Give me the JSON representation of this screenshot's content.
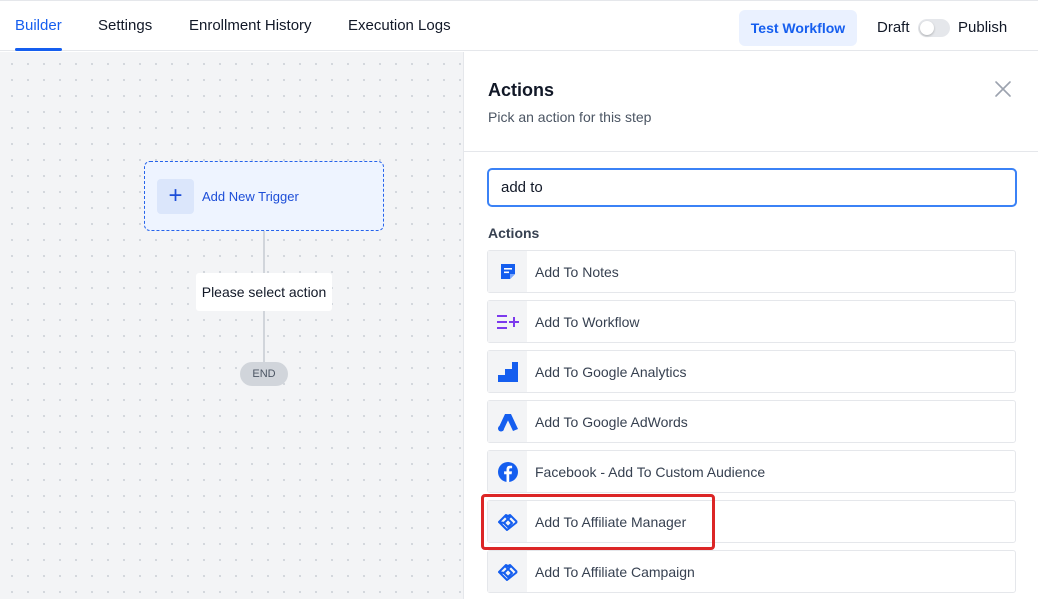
{
  "tabs": [
    {
      "label": "Builder",
      "active": true
    },
    {
      "label": "Settings",
      "active": false
    },
    {
      "label": "Enrollment History",
      "active": false
    },
    {
      "label": "Execution Logs",
      "active": false
    }
  ],
  "header": {
    "test_button": "Test Workflow",
    "draft_label": "Draft",
    "publish_label": "Publish",
    "publish_enabled": false
  },
  "canvas": {
    "trigger_label": "Add New Trigger",
    "action_placeholder": "Please select action",
    "end_label": "END"
  },
  "panel": {
    "title": "Actions",
    "subtitle": "Pick an action for this step",
    "search_value": "add to",
    "section_label": "Actions",
    "items": [
      {
        "label": "Add To Notes",
        "icon": "notes-icon"
      },
      {
        "label": "Add To Workflow",
        "icon": "workflow-icon"
      },
      {
        "label": "Add To Google Analytics",
        "icon": "google-analytics-icon"
      },
      {
        "label": "Add To Google AdWords",
        "icon": "google-ads-icon"
      },
      {
        "label": "Facebook - Add To Custom Audience",
        "icon": "facebook-icon"
      },
      {
        "label": "Add To Affiliate Manager",
        "icon": "handshake-icon",
        "highlighted": true
      },
      {
        "label": "Add To Affiliate Campaign",
        "icon": "handshake-icon"
      }
    ]
  },
  "colors": {
    "accent": "#155eef",
    "highlight": "#dc2626",
    "workflow_icon": "#7c3aed",
    "facebook": "#1877f2"
  }
}
